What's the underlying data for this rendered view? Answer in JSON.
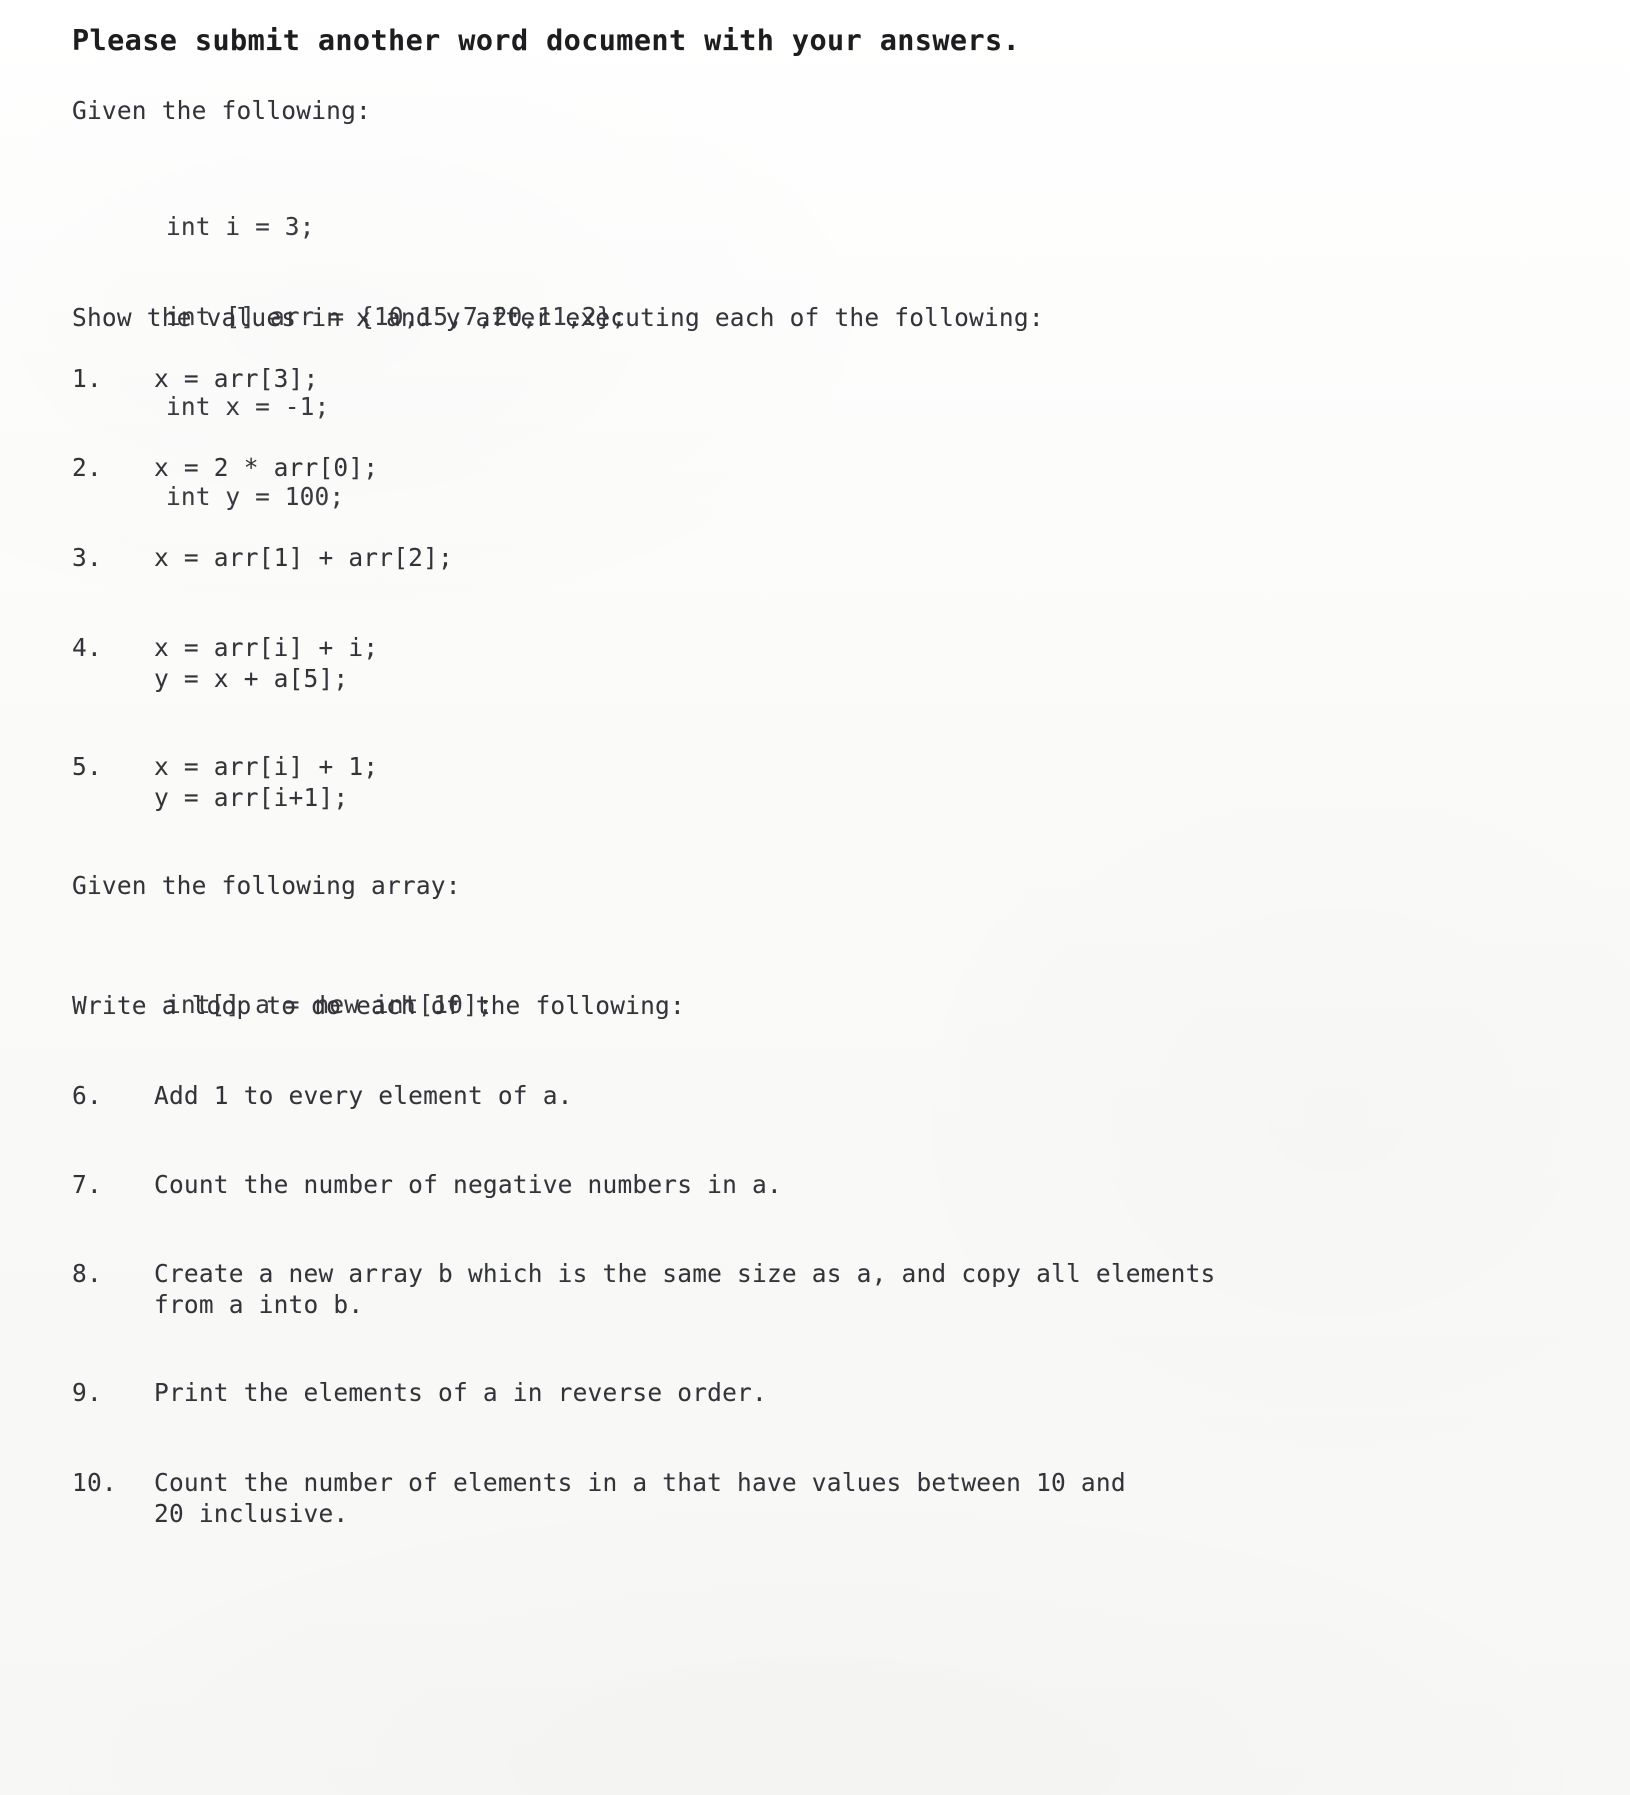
{
  "document": {
    "title": "Please submit another word document with your answers.",
    "section_one": {
      "intro": "Given the following:",
      "code": [
        "int i = 3;",
        "int [] arr = {10,15,7,20,11,2};",
        "int x = -1;",
        "int y = 100;"
      ],
      "instruction": "Show the values in x and y after executing each of the following:",
      "items": [
        {
          "number": "1.",
          "lines": [
            "x = arr[3];"
          ]
        },
        {
          "number": "2.",
          "lines": [
            "x = 2 * arr[0];"
          ]
        },
        {
          "number": "3.",
          "lines": [
            "x = arr[1] + arr[2];"
          ]
        },
        {
          "number": "4.",
          "lines": [
            "x = arr[i] + i;",
            "y = x + a[5];"
          ]
        },
        {
          "number": "5.",
          "lines": [
            "x = arr[i] + 1;",
            "y = arr[i+1];"
          ]
        }
      ]
    },
    "section_two": {
      "intro": "Given the following array:",
      "code": [
        "int[] a = new int[10];"
      ],
      "instruction": "Write a loop to do each of the following:",
      "items": [
        {
          "number": "6.",
          "lines": [
            "Add 1 to every element of a."
          ]
        },
        {
          "number": "7.",
          "lines": [
            "Count the number of negative numbers in a."
          ]
        },
        {
          "number": "8.",
          "lines": [
            "Create a new array b which is the same size as a, and copy all elements",
            "from a into b."
          ]
        },
        {
          "number": "9.",
          "lines": [
            "Print the elements of a in reverse order."
          ]
        },
        {
          "number": "10.",
          "lines": [
            "Count the number of elements in a that have values between 10 and",
            "20 inclusive."
          ]
        }
      ]
    }
  }
}
